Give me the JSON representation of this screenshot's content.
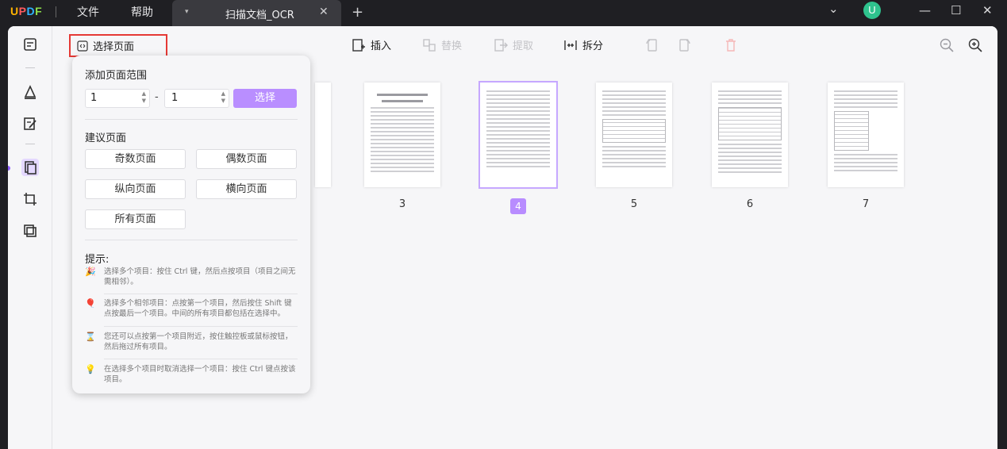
{
  "titlebar": {
    "logo": {
      "u": "U",
      "p": "P",
      "d": "D",
      "f": "F"
    },
    "menu": [
      "文件",
      "帮助"
    ],
    "tab_title": "扫描文档_OCR",
    "tab_arrow": "▾",
    "tab_close": "✕",
    "tab_add": "+",
    "avatar_letter": "U",
    "chevron": "⌄",
    "minimize": "—",
    "maximize": "☐",
    "close": "✕"
  },
  "toolbar": {
    "select_pages": "选择页面",
    "insert": "插入",
    "replace": "替换",
    "extract": "提取",
    "split": "拆分"
  },
  "panel": {
    "add_range_title": "添加页面范围",
    "range_from": "1",
    "range_to": "1",
    "range_dash": "-",
    "select_button": "选择",
    "suggest_title": "建议页面",
    "odd": "奇数页面",
    "even": "偶数页面",
    "portrait": "纵向页面",
    "landscape": "横向页面",
    "all": "所有页面",
    "tips_title": "提示:",
    "tips": [
      {
        "icon": "🎉",
        "text": "选择多个项目：按住 Ctrl 键，然后点按项目（项目之间无需相邻）。"
      },
      {
        "icon": "🎈",
        "text": "选择多个相邻项目：点按第一个项目，然后按住 Shift 键点按最后一个项目。中间的所有项目都包括在选择中。"
      },
      {
        "icon": "⌛",
        "text": "您还可以点按第一个项目附近，按住触控板或鼠标按钮，然后拖过所有项目。"
      },
      {
        "icon": "💡",
        "text": "在选择多个项目时取消选择一个项目：按住 Ctrl 键点按该项目。"
      }
    ]
  },
  "pages": [
    {
      "number": "3",
      "selected": false
    },
    {
      "number": "4",
      "selected": true
    },
    {
      "number": "5",
      "selected": false
    },
    {
      "number": "6",
      "selected": false
    },
    {
      "number": "7",
      "selected": false
    }
  ],
  "colors": {
    "accent": "#b98eff",
    "highlight_border": "#e53935"
  }
}
